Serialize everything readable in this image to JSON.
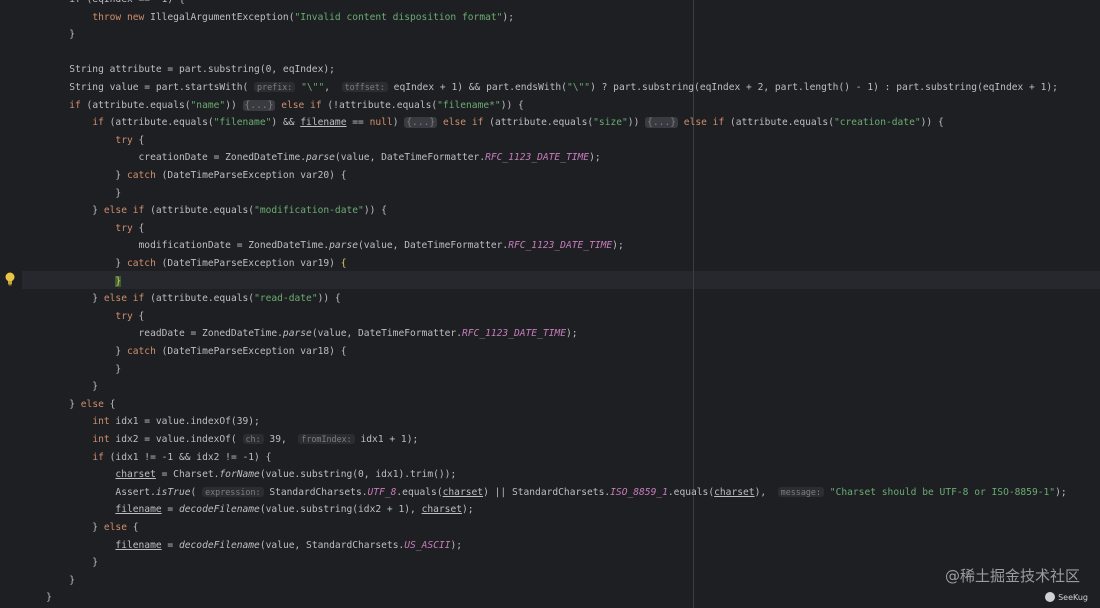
{
  "editor": {
    "lines": [
      [
        {
          "t": "        if (eqIndex == -1) {"
        }
      ],
      [
        {
          "t": "            "
        },
        {
          "t": "throw new ",
          "c": "kw"
        },
        {
          "t": "IllegalArgumentException("
        },
        {
          "t": "\"Invalid content disposition format\"",
          "c": "str"
        },
        {
          "t": ");"
        }
      ],
      [
        {
          "t": "        }"
        }
      ],
      [
        {
          "t": ""
        }
      ],
      [
        {
          "t": "        String attribute = part.substring(0, eqIndex);"
        }
      ],
      [
        {
          "t": "        String value = part.startsWith( "
        },
        {
          "t": "prefix:",
          "c": "hint"
        },
        {
          "t": " "
        },
        {
          "t": "\"\\\"\"",
          "c": "str"
        },
        {
          "t": ",  "
        },
        {
          "t": "toffset:",
          "c": "hint"
        },
        {
          "t": " eqIndex + 1) && part.endsWith("
        },
        {
          "t": "\"\\\"\"",
          "c": "str"
        },
        {
          "t": ") ? part.substring(eqIndex + 2, part.length() - 1) : part.substring(eqIndex + 1);"
        }
      ],
      [
        {
          "t": "        "
        },
        {
          "t": "if",
          "c": "kw"
        },
        {
          "t": " (attribute.equals("
        },
        {
          "t": "\"name\"",
          "c": "str"
        },
        {
          "t": ")) "
        },
        {
          "t": "{...}",
          "c": "fold"
        },
        {
          "t": " "
        },
        {
          "t": "else if",
          "c": "kw"
        },
        {
          "t": " (!attribute.equals("
        },
        {
          "t": "\"filename*\"",
          "c": "str"
        },
        {
          "t": ")) {"
        }
      ],
      [
        {
          "t": "            "
        },
        {
          "t": "if",
          "c": "kw"
        },
        {
          "t": " (attribute.equals("
        },
        {
          "t": "\"filename\"",
          "c": "str"
        },
        {
          "t": ") && "
        },
        {
          "t": "filename",
          "c": "und"
        },
        {
          "t": " == "
        },
        {
          "t": "null",
          "c": "kw"
        },
        {
          "t": ") "
        },
        {
          "t": "{...}",
          "c": "fold"
        },
        {
          "t": " "
        },
        {
          "t": "else if",
          "c": "kw"
        },
        {
          "t": " (attribute.equals("
        },
        {
          "t": "\"size\"",
          "c": "str"
        },
        {
          "t": ")) "
        },
        {
          "t": "{...}",
          "c": "fold"
        },
        {
          "t": " "
        },
        {
          "t": "else if",
          "c": "kw"
        },
        {
          "t": " (attribute.equals("
        },
        {
          "t": "\"creation-date\"",
          "c": "str"
        },
        {
          "t": ")) {"
        }
      ],
      [
        {
          "t": "                "
        },
        {
          "t": "try",
          "c": "kw"
        },
        {
          "t": " {"
        }
      ],
      [
        {
          "t": "                    creationDate = ZonedDateTime."
        },
        {
          "t": "parse",
          "c": "st"
        },
        {
          "t": "(value, DateTimeFormatter."
        },
        {
          "t": "RFC_1123_DATE_TIME",
          "c": "italic"
        },
        {
          "t": ");"
        }
      ],
      [
        {
          "t": "                } "
        },
        {
          "t": "catch",
          "c": "kw"
        },
        {
          "t": " (DateTimeParseException var20) {"
        }
      ],
      [
        {
          "t": "                }"
        }
      ],
      [
        {
          "t": "            } "
        },
        {
          "t": "else if",
          "c": "kw"
        },
        {
          "t": " (attribute.equals("
        },
        {
          "t": "\"modification-date\"",
          "c": "str"
        },
        {
          "t": ")) {"
        }
      ],
      [
        {
          "t": "                "
        },
        {
          "t": "try",
          "c": "kw"
        },
        {
          "t": " {"
        }
      ],
      [
        {
          "t": "                    modificationDate = ZonedDateTime."
        },
        {
          "t": "parse",
          "c": "st"
        },
        {
          "t": "(value, DateTimeFormatter."
        },
        {
          "t": "RFC_1123_DATE_TIME",
          "c": "italic"
        },
        {
          "t": ");"
        }
      ],
      [
        {
          "t": "                } "
        },
        {
          "t": "catch",
          "c": "kw"
        },
        {
          "t": " (DateTimeParseException var19) "
        },
        {
          "t": "{",
          "c": "matchbrace"
        }
      ],
      [
        {
          "t": "                "
        },
        {
          "t": "}",
          "c": "caretbrace"
        }
      ],
      [
        {
          "t": "            } "
        },
        {
          "t": "else if",
          "c": "kw"
        },
        {
          "t": " (attribute.equals("
        },
        {
          "t": "\"read-date\"",
          "c": "str"
        },
        {
          "t": ")) {"
        }
      ],
      [
        {
          "t": "                "
        },
        {
          "t": "try",
          "c": "kw"
        },
        {
          "t": " {"
        }
      ],
      [
        {
          "t": "                    readDate = ZonedDateTime."
        },
        {
          "t": "parse",
          "c": "st"
        },
        {
          "t": "(value, DateTimeFormatter."
        },
        {
          "t": "RFC_1123_DATE_TIME",
          "c": "italic"
        },
        {
          "t": ");"
        }
      ],
      [
        {
          "t": "                } "
        },
        {
          "t": "catch",
          "c": "kw"
        },
        {
          "t": " (DateTimeParseException var18) {"
        }
      ],
      [
        {
          "t": "                }"
        }
      ],
      [
        {
          "t": "            }"
        }
      ],
      [
        {
          "t": "        } "
        },
        {
          "t": "else",
          "c": "kw"
        },
        {
          "t": " {"
        }
      ],
      [
        {
          "t": "            "
        },
        {
          "t": "int",
          "c": "kw"
        },
        {
          "t": " idx1 = value.indexOf(39);"
        }
      ],
      [
        {
          "t": "            "
        },
        {
          "t": "int",
          "c": "kw"
        },
        {
          "t": " idx2 = value.indexOf( "
        },
        {
          "t": "ch:",
          "c": "hint"
        },
        {
          "t": " 39,  "
        },
        {
          "t": "fromIndex:",
          "c": "hint"
        },
        {
          "t": " idx1 + 1);"
        }
      ],
      [
        {
          "t": "            "
        },
        {
          "t": "if",
          "c": "kw"
        },
        {
          "t": " (idx1 != -1 && idx2 != -1) {"
        }
      ],
      [
        {
          "t": "                "
        },
        {
          "t": "charset",
          "c": "und"
        },
        {
          "t": " = Charset."
        },
        {
          "t": "forName",
          "c": "st"
        },
        {
          "t": "(value.substring(0, idx1).trim());"
        }
      ],
      [
        {
          "t": "                Assert."
        },
        {
          "t": "isTrue",
          "c": "st"
        },
        {
          "t": "( "
        },
        {
          "t": "expression:",
          "c": "hint"
        },
        {
          "t": " StandardCharsets."
        },
        {
          "t": "UTF_8",
          "c": "italic"
        },
        {
          "t": ".equals("
        },
        {
          "t": "charset",
          "c": "und"
        },
        {
          "t": ") || StandardCharsets."
        },
        {
          "t": "ISO_8859_1",
          "c": "italic"
        },
        {
          "t": ".equals("
        },
        {
          "t": "charset",
          "c": "und"
        },
        {
          "t": "),  "
        },
        {
          "t": "message:",
          "c": "hint"
        },
        {
          "t": " "
        },
        {
          "t": "\"Charset should be UTF-8 or ISO-8859-1\"",
          "c": "str"
        },
        {
          "t": ");"
        }
      ],
      [
        {
          "t": "                "
        },
        {
          "t": "filename",
          "c": "und"
        },
        {
          "t": " = "
        },
        {
          "t": "decodeFilename",
          "c": "st"
        },
        {
          "t": "(value.substring(idx2 + 1), "
        },
        {
          "t": "charset",
          "c": "und"
        },
        {
          "t": ");"
        }
      ],
      [
        {
          "t": "            } "
        },
        {
          "t": "else",
          "c": "kw"
        },
        {
          "t": " {"
        }
      ],
      [
        {
          "t": "                "
        },
        {
          "t": "filename",
          "c": "und"
        },
        {
          "t": " = "
        },
        {
          "t": "decodeFilename",
          "c": "st"
        },
        {
          "t": "(value, StandardCharsets."
        },
        {
          "t": "US_ASCII",
          "c": "italic"
        },
        {
          "t": ");"
        }
      ],
      [
        {
          "t": "            }"
        }
      ],
      [
        {
          "t": "        }"
        }
      ],
      [
        {
          "t": "    }"
        }
      ]
    ]
  },
  "gutter": {
    "icon": "lightbulb-icon"
  },
  "watermark": {
    "text": "@稀土掘金技术社区",
    "logo_text": "SeeKug"
  }
}
